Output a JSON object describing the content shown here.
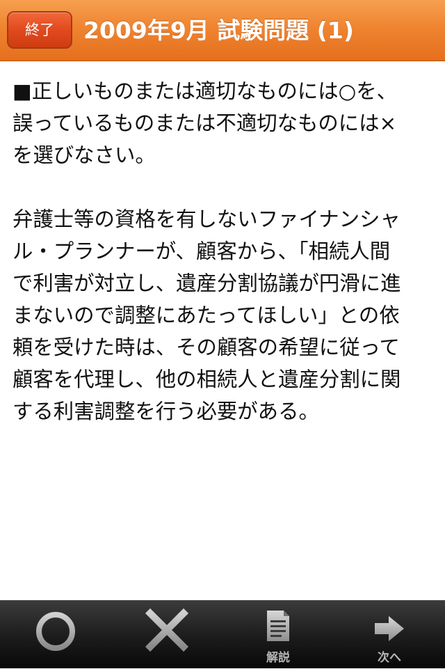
{
  "navbar": {
    "end_button": "終了",
    "title": "2009年9月  試験問題 (1)"
  },
  "question": {
    "instruction": "■正しいものまたは適切なものには○を、\n誤っているものまたは不適切なものには×\nを選びなさい。",
    "body": "弁護士等の資格を有しないファイナンシャ\nル・プランナーが、顧客から、「相続人間\nで利害が対立し、遺産分割協議が円滑に進\nまないので調整にあたってほしい」との依\n頼を受けた時は、その顧客の希望に従って\n顧客を代理し、他の相続人と遺産分割に関\nする利害調整を行う必要がある。"
  },
  "toolbar": {
    "maru_icon": "circle-icon",
    "batsu_icon": "cross-icon",
    "explanation_label": "解説",
    "explanation_icon": "document-icon",
    "next_label": "次へ",
    "next_icon": "arrow-right-icon"
  }
}
